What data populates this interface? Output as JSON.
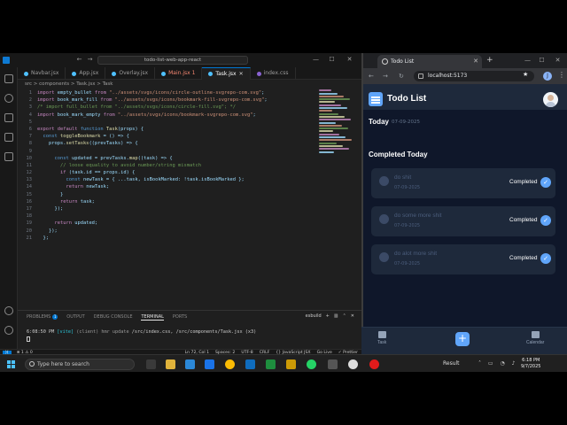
{
  "vscode": {
    "search": "todo-list-web-app-react",
    "tabs": [
      {
        "label": "Navbar.jsx",
        "active": false
      },
      {
        "label": "App.jsx",
        "active": false
      },
      {
        "label": "Overlay.jsx",
        "active": false
      },
      {
        "label": "Main.jsx 1",
        "active": false
      },
      {
        "label": "Task.jsx",
        "active": true
      },
      {
        "label": "index.css",
        "active": false
      }
    ],
    "breadcrumb": "src > components > Task.jsx > Task",
    "code": [
      {
        "n": "1",
        "t": "import empty_bullet from \"../assets/svgs/icons/circle-outline-svgrepo-com.svg\";"
      },
      {
        "n": "2",
        "t": "import book_mark_fill from \"../assets/svgs/icons/bookmark-fill-svgrepo-com.svg\";"
      },
      {
        "n": "3",
        "t": "/* import full_bullet from \"../assets/svgs/icons/circle-fill.svg\"; */"
      },
      {
        "n": "4",
        "t": "import book_mark_empty from \"../assets/svgs/icons/bookmark-svgrepo-com.svg\";"
      },
      {
        "n": "5",
        "t": ""
      },
      {
        "n": "6",
        "t": "export default function Task(props) {"
      },
      {
        "n": "7",
        "t": "  const toggleBookmark = () => {"
      },
      {
        "n": "8",
        "t": "    props.setTasks((prevTasks) => {"
      },
      {
        "n": "9",
        "t": ""
      },
      {
        "n": "10",
        "t": "      const updated = prevTasks.map((task) => {"
      },
      {
        "n": "11",
        "t": "        // loose equality to avoid number/string mismatch"
      },
      {
        "n": "12",
        "t": "        if (task.id == props.id) {"
      },
      {
        "n": "13",
        "t": "          const newTask = { ...task, isBookMarked: !task.isBookMarked };"
      },
      {
        "n": "14",
        "t": "          return newTask;"
      },
      {
        "n": "15",
        "t": "        }"
      },
      {
        "n": "16",
        "t": "        return task;"
      },
      {
        "n": "17",
        "t": "      });"
      },
      {
        "n": "18",
        "t": ""
      },
      {
        "n": "19",
        "t": "      return updated;"
      },
      {
        "n": "20",
        "t": "    });"
      },
      {
        "n": "21",
        "t": "  };"
      }
    ],
    "panel": {
      "tabs": [
        "PROBLEMS",
        "OUTPUT",
        "DEBUG CONSOLE",
        "TERMINAL",
        "PORTS"
      ],
      "problems_count": "1",
      "shell": "esbuild",
      "terminal_time": "6:08:50 PM",
      "terminal_tag": "[vite]",
      "terminal_msg": "(client) hmr update",
      "terminal_path": "/src/index.css, /src/components/Task.jsx (x3)"
    },
    "status": {
      "errors": "⊗ 1 ⚠ 0",
      "position": "Ln 72, Col 1",
      "spaces": "Spaces: 2",
      "encoding": "UTF-8",
      "eol": "CRLF",
      "language": "{} JavaScript JSX",
      "golive": "Go Live",
      "prettier": "✓ Prettier"
    }
  },
  "browser": {
    "tab_title": "Todo List",
    "url": "localhost:5173",
    "profile_initial": "J"
  },
  "app": {
    "title": "Todo List",
    "today_label": "Today",
    "today_date": "07-09-2025",
    "section_title": "Completed Today",
    "tasks": [
      {
        "title": "do shit",
        "date": "07-09-2025",
        "status": "Completed"
      },
      {
        "title": "do some more shit",
        "date": "07-09-2025",
        "status": "Completed"
      },
      {
        "title": "do alot more shit",
        "date": "07-09-2025",
        "status": "Completed"
      }
    ],
    "nav": {
      "task": "Task",
      "add": "+",
      "calendar": "Calendar"
    }
  },
  "taskbar": {
    "search_placeholder": "Type here to search",
    "weather": "Result",
    "time": "6:18 PM",
    "date": "9/7/2025"
  },
  "colors": {
    "app_bg": "#0f172a",
    "card_bg": "#1e293b",
    "accent": "#60a5fa"
  }
}
